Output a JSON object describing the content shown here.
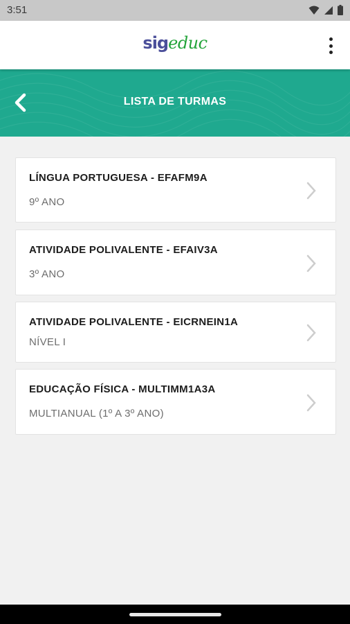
{
  "status_bar": {
    "time": "3:51",
    "icons": [
      "wifi-icon",
      "signal-icon",
      "battery-icon"
    ]
  },
  "app_bar": {
    "logo_part1": "sig",
    "logo_part2": "educ",
    "menu_icon": "more-vert-icon"
  },
  "header": {
    "title": "LISTA DE TURMAS",
    "back_icon": "chevron-left-icon",
    "color": "#1fa98f"
  },
  "classes": [
    {
      "title": "LÍNGUA PORTUGUESA - EFAFM9A",
      "subtitle": "9º ANO"
    },
    {
      "title": "ATIVIDADE POLIVALENTE - EFAIV3A",
      "subtitle": "3º ANO"
    },
    {
      "title": "ATIVIDADE POLIVALENTE - EICRNEIN1A",
      "subtitle": "NÍVEL I"
    },
    {
      "title": "EDUCAÇÃO FÍSICA - MULTIMM1A3A",
      "subtitle": "MULTIANUAL (1º A 3º ANO)"
    }
  ]
}
